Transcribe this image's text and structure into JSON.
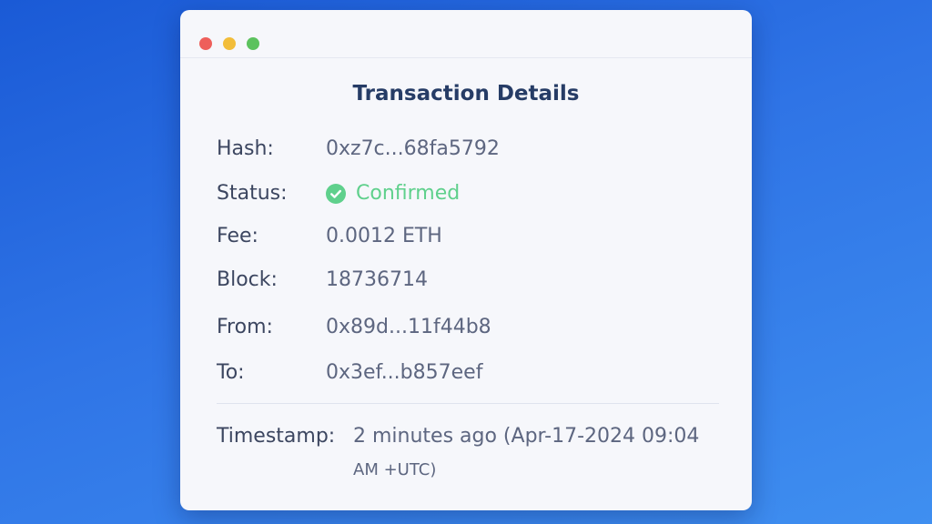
{
  "window": {
    "title": "Transaction Details"
  },
  "fields": {
    "hash": {
      "label": "Hash:",
      "value": "0xz7c...68fa5792"
    },
    "status": {
      "label": "Status:",
      "value": "Confirmed",
      "icon": "check-circle-icon",
      "color": "#5fd08c"
    },
    "fee": {
      "label": "Fee:",
      "value": "0.0012 ETH"
    },
    "block": {
      "label": "Block:",
      "value": "18736714"
    },
    "from": {
      "label": "From:",
      "value": "0x89d...11f44b8"
    },
    "to": {
      "label": "To:",
      "value": "0x3ef...b857eef"
    }
  },
  "timestamp": {
    "label": "Timestamp:",
    "line1": "2 minutes ago (Apr-17-2024 09:04",
    "line2": "AM +UTC)"
  },
  "colors": {
    "background_top": "#1a5ad6",
    "background_bottom": "#3f8ff0",
    "title": "#263c66",
    "confirmed": "#5fd08c"
  }
}
